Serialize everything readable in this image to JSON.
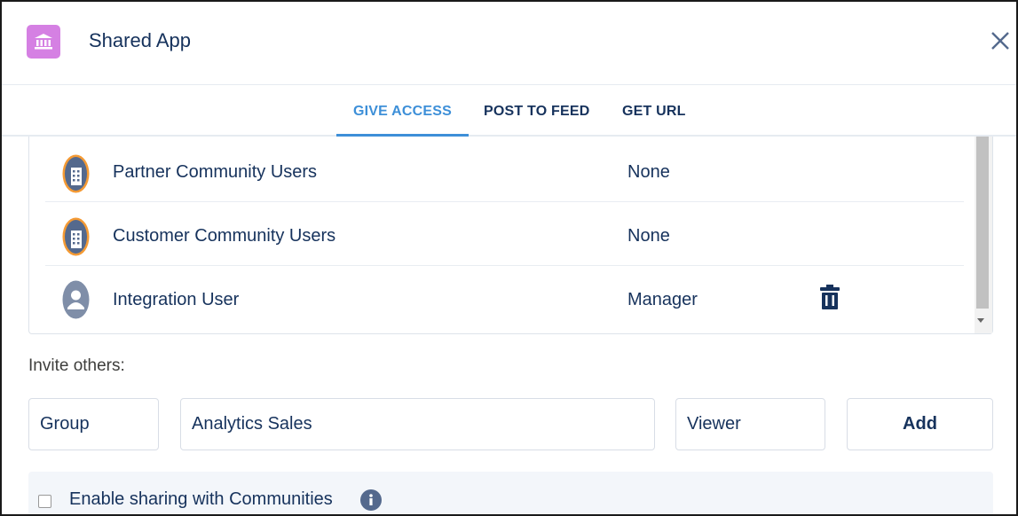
{
  "header": {
    "title": "Shared App",
    "icon": "bank-icon",
    "close_label": "×"
  },
  "tabs": [
    {
      "label": "GIVE ACCESS",
      "active": true
    },
    {
      "label": "POST TO FEED",
      "active": false
    },
    {
      "label": "GET URL",
      "active": false
    }
  ],
  "access_list": [
    {
      "name": "Partner Community Users",
      "access": "None",
      "avatar": "building-avatar-icon",
      "deletable": false
    },
    {
      "name": "Customer Community Users",
      "access": "None",
      "avatar": "building-avatar-icon",
      "deletable": false
    },
    {
      "name": "Integration User",
      "access": "Manager",
      "avatar": "user-avatar-icon",
      "deletable": true
    }
  ],
  "invite": {
    "label": "Invite others:",
    "type_value": "Group",
    "target_value": "Analytics Sales",
    "access_value": "Viewer",
    "add_label": "Add"
  },
  "footer": {
    "checkbox_label": "Enable sharing with Communities",
    "checked": false
  },
  "colors": {
    "accent": "#3d8fd8",
    "app_icon": "#d580e3",
    "text": "#16325c",
    "community_avatar_ring": "#f49a34"
  }
}
